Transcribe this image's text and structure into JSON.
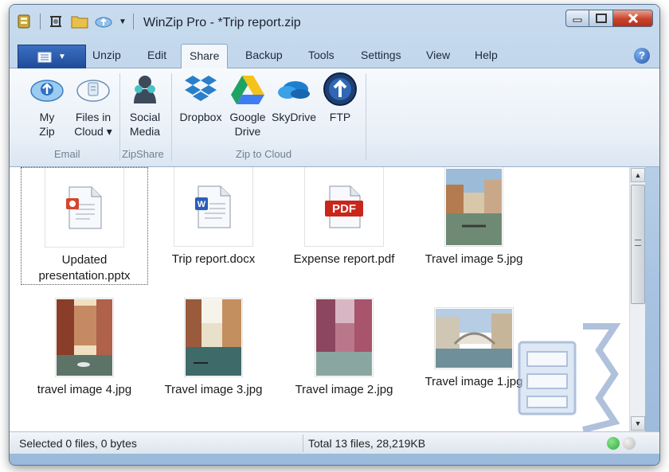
{
  "window": {
    "title": "WinZip Pro - *Trip report.zip"
  },
  "tabs": [
    {
      "label": "Unzip"
    },
    {
      "label": "Edit"
    },
    {
      "label": "Share"
    },
    {
      "label": "Backup"
    },
    {
      "label": "Tools"
    },
    {
      "label": "Settings"
    },
    {
      "label": "View"
    },
    {
      "label": "Help"
    }
  ],
  "active_tab": "Share",
  "help_glyph": "?",
  "ribbon": {
    "email": {
      "group_label": "Email",
      "my_zip": [
        "My",
        "Zip"
      ],
      "files_in_cloud": [
        "Files in",
        "Cloud ▾"
      ]
    },
    "zipshare": {
      "group_label": "ZipShare",
      "social_media": [
        "Social",
        "Media"
      ]
    },
    "cloud": {
      "group_label": "Zip to Cloud",
      "dropbox": "Dropbox",
      "google_drive": [
        "Google",
        "Drive"
      ],
      "skydrive": "SkyDrive",
      "ftp": "FTP"
    }
  },
  "files": [
    {
      "name_line1": "Updated",
      "name_line2": "presentation.pptx",
      "kind": "pptx"
    },
    {
      "name_line1": "Trip report.docx",
      "kind": "docx"
    },
    {
      "name_line1": "Expense report.pdf",
      "kind": "pdf",
      "badge": "PDF"
    },
    {
      "name_line1": "Travel image 5.jpg",
      "kind": "jpg"
    },
    {
      "name_line1": "travel image 4.jpg",
      "kind": "jpg"
    },
    {
      "name_line1": "Travel image 3.jpg",
      "kind": "jpg"
    },
    {
      "name_line1": "Travel image 2.jpg",
      "kind": "jpg"
    },
    {
      "name_line1": "Travel image 1.jpg",
      "kind": "jpg"
    }
  ],
  "status": {
    "selected": "Selected 0 files, 0 bytes",
    "total": "Total 13 files, 28,219KB"
  },
  "colors": {
    "accent": "#1e4b98",
    "status_green": "#2fae3a",
    "status_gray": "#bcbcbc",
    "pdf_red": "#c9261c"
  }
}
